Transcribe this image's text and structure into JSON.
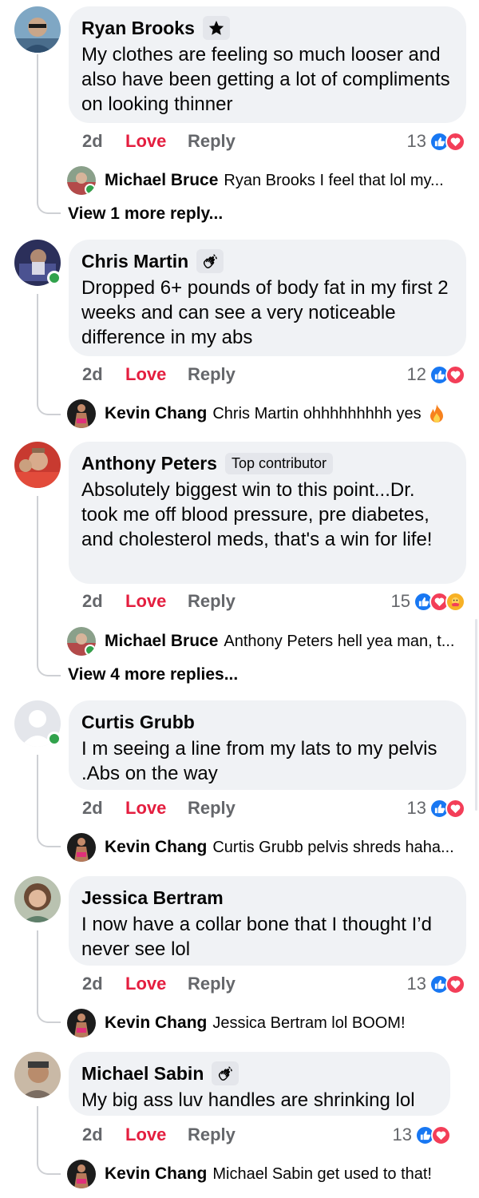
{
  "comments": [
    {
      "name": "Ryan Brooks",
      "badge": "",
      "text": "My clothes are feeling so much looser and also have been getting a lot of compliments on looking thinner",
      "time": "2d",
      "love": "Love",
      "reply": "Reply",
      "reaction_count": "13",
      "reply_preview": {
        "name": "Michael Bruce",
        "text": "Ryan Brooks I feel that lol my..."
      },
      "view_more": "View 1 more reply..."
    },
    {
      "name": "Chris Martin",
      "badge": "",
      "text": "Dropped 6+ pounds of body fat in my first 2 weeks and can see a very noticeable difference in my abs",
      "time": "2d",
      "love": "Love",
      "reply": "Reply",
      "reaction_count": "12",
      "reply_preview": {
        "name": "Kevin Chang",
        "text": "Chris Martin ohhhhhhhhh yes"
      }
    },
    {
      "name": "Anthony Peters",
      "badge": "Top contributor",
      "text": "Absolutely biggest win to this point...Dr. took me off blood pressure, pre diabetes, and cholesterol meds, that's a win for life!",
      "time": "2d",
      "love": "Love",
      "reply": "Reply",
      "reaction_count": "15",
      "reply_preview": {
        "name": "Michael Bruce",
        "text": "Anthony Peters hell yea man, t..."
      },
      "view_more": "View 4 more replies..."
    },
    {
      "name": "Curtis Grubb",
      "badge": "",
      "text": "I m seeing a line from my lats to my pelvis .Abs on the way",
      "time": "2d",
      "love": "Love",
      "reply": "Reply",
      "reaction_count": "13",
      "reply_preview": {
        "name": "Kevin Chang",
        "text": "Curtis Grubb pelvis shreds haha..."
      }
    },
    {
      "name": "Jessica Bertram",
      "badge": "",
      "text": "I now have a collar bone that I thought I’d never see lol",
      "time": "2d",
      "love": "Love",
      "reply": "Reply",
      "reaction_count": "13",
      "reply_preview": {
        "name": "Kevin Chang",
        "text": "Jessica Bertram lol BOOM!"
      }
    },
    {
      "name": "Michael Sabin",
      "badge": "",
      "text": "My big ass luv handles are shrinking lol",
      "time": "2d",
      "love": "Love",
      "reply": "Reply",
      "reaction_count": "13",
      "reply_preview": {
        "name": "Kevin Chang",
        "text": "Michael Sabin get used to that!"
      }
    }
  ],
  "colors": {
    "love": "#e41e3f",
    "like": "#1877f2",
    "online": "#31a24c",
    "bubble": "#f0f2f5"
  },
  "icons": [
    "star-badge-icon",
    "wave-hand-badge-icon",
    "like-reaction-icon",
    "love-reaction-icon",
    "care-reaction-icon",
    "fire-emoji-icon"
  ]
}
